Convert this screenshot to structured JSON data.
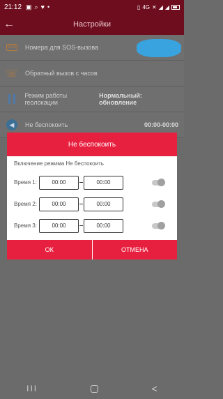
{
  "status_bar": {
    "time": "21:12",
    "left_icons": [
      "gallery-icon",
      "search-icon",
      "heart-icon",
      "more-dots-icon"
    ],
    "right_icons": [
      "sim-icon",
      "network-4g-icon",
      "mute-icon",
      "signal-icon",
      "signal-icon",
      "battery-icon"
    ],
    "net": "4G"
  },
  "toolbar": {
    "title": "Настройки",
    "back_icon": "arrow-left-icon"
  },
  "settings": {
    "items": [
      {
        "label": "Номера для SOS-вызова",
        "icon": "sos-icon",
        "value": ""
      },
      {
        "label": "Обратный вызов с часов",
        "icon": "phone-icon",
        "value": ""
      },
      {
        "label": "Режим работы геолокации",
        "icon": "geo-icon",
        "value": "Нормальный: обновление"
      },
      {
        "label": "Не беспокоить",
        "icon": "speaker-icon",
        "value": "00:00-00:00"
      }
    ]
  },
  "dialog": {
    "title": "Не беспокоить",
    "subtitle": "Включение режима Не беспокоить",
    "rows": [
      {
        "label": "Время 1:",
        "start": "00:00",
        "end": "00:00",
        "enabled": false
      },
      {
        "label": "Время 2:",
        "start": "00:00",
        "end": "00:00",
        "enabled": false
      },
      {
        "label": "Время 3:",
        "start": "00:00",
        "end": "00:00",
        "enabled": false
      }
    ],
    "ok_label": "ОК",
    "cancel_label": "ОТМЕНА"
  },
  "nav_bar": {
    "recent_glyph": "III",
    "back_glyph": "<"
  },
  "colors": {
    "accent": "#e8203f",
    "header": "#6e0d1e",
    "overlay": "#6b6b6b"
  }
}
